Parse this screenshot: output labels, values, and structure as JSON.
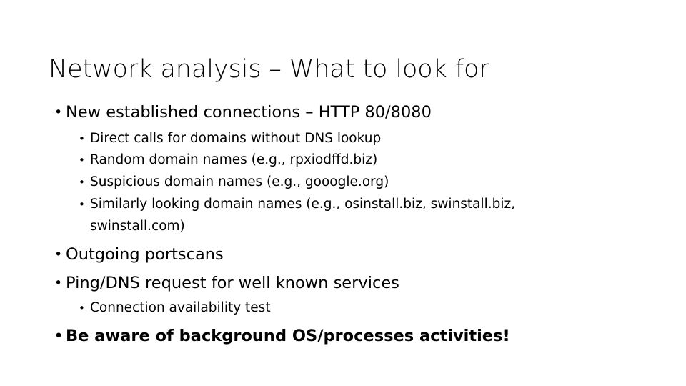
{
  "slide": {
    "title": "Network analysis – What to look for",
    "bullet_glyph": "•",
    "background_color": "#ffffff",
    "text_color": "#000000",
    "content": [
      {
        "level": 1,
        "text": "New established connections – HTTP 80/8080"
      },
      {
        "level": 2,
        "text": "Direct calls for domains without DNS lookup"
      },
      {
        "level": 2,
        "text": "Random domain names (e.g., rpxiodffd.biz)"
      },
      {
        "level": 2,
        "text": "Suspicious domain names (e.g., gooogle.org)"
      },
      {
        "level": 2,
        "text": "Similarly looking domain names (e.g., osinstall.biz, swinstall.biz, swinstall.com)"
      },
      {
        "level": 1,
        "text": "Outgoing portscans"
      },
      {
        "level": 1,
        "text": "Ping/DNS request for well known services"
      },
      {
        "level": 2,
        "text": "Connection availability test"
      },
      {
        "level": 1,
        "text": "Be aware of background OS/processes activities!"
      }
    ]
  }
}
